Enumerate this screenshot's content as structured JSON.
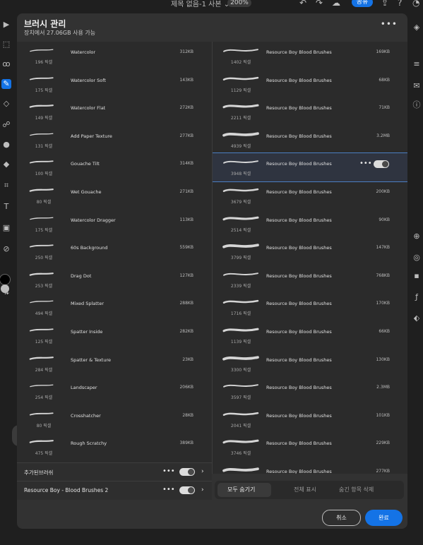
{
  "topbar": {
    "doc_title": "제목 없음-1 사본 ⌄",
    "zoom": "200%",
    "share_label": "공유"
  },
  "dialog": {
    "title": "브러시 관리",
    "subtitle": "장치에서 27.06GB 사용 가능",
    "left_brushes": [
      {
        "name": "Watercolor",
        "size": "312KB",
        "px": "196 픽셀"
      },
      {
        "name": "Watercolor Soft",
        "size": "143KB",
        "px": "175 픽셀"
      },
      {
        "name": "Watercolor Flat",
        "size": "272KB",
        "px": "149 픽셀"
      },
      {
        "name": "Add Paper Texture",
        "size": "277KB",
        "px": "131 픽셀"
      },
      {
        "name": "Gouache Tilt",
        "size": "314KB",
        "px": "100 픽셀"
      },
      {
        "name": "Wet Gouache",
        "size": "271KB",
        "px": "80 픽셀"
      },
      {
        "name": "Watercolor Dragger",
        "size": "113KB",
        "px": "175 픽셀"
      },
      {
        "name": "60s Background",
        "size": "559KB",
        "px": "250 픽셀"
      },
      {
        "name": "Drag Dot",
        "size": "127KB",
        "px": "253 픽셀"
      },
      {
        "name": "Mixed Splatter",
        "size": "288KB",
        "px": "494 픽셀"
      },
      {
        "name": "Spatter Inside",
        "size": "282KB",
        "px": "125 픽셀"
      },
      {
        "name": "Spatter & Texture",
        "size": "23KB",
        "px": "284 픽셀"
      },
      {
        "name": "Landscaper",
        "size": "206KB",
        "px": "254 픽셀"
      },
      {
        "name": "Crosshatcher",
        "size": "28KB",
        "px": "80 픽셀"
      },
      {
        "name": "Rough Scratchy",
        "size": "389KB",
        "px": "475 픽셀"
      }
    ],
    "right_brushes": [
      {
        "name": "Resource Boy Blood Brushes",
        "size": "169KB",
        "px": "1402 픽셀"
      },
      {
        "name": "Resource Boy Blood Brushes",
        "size": "68KB",
        "px": "1129 픽셀"
      },
      {
        "name": "Resource Boy Blood Brushes",
        "size": "71KB",
        "px": "2211 픽셀"
      },
      {
        "name": "Resource Boy Blood Brushes",
        "size": "3.2MB",
        "px": "4939 픽셀"
      },
      {
        "name": "Resource Boy Blood Brushes",
        "size": "",
        "px": "3948 픽셀",
        "selected": true
      },
      {
        "name": "Resource Boy Blood Brushes",
        "size": "200KB",
        "px": "3679 픽셀"
      },
      {
        "name": "Resource Boy Blood Brushes",
        "size": "90KB",
        "px": "2514 픽셀"
      },
      {
        "name": "Resource Boy Blood Brushes",
        "size": "147KB",
        "px": "3799 픽셀"
      },
      {
        "name": "Resource Boy Blood Brushes",
        "size": "768KB",
        "px": "2339 픽셀"
      },
      {
        "name": "Resource Boy Blood Brushes",
        "size": "170KB",
        "px": "1716 픽셀"
      },
      {
        "name": "Resource Boy Blood Brushes",
        "size": "66KB",
        "px": "1139 픽셀"
      },
      {
        "name": "Resource Boy Blood Brushes",
        "size": "130KB",
        "px": "3300 픽셀"
      },
      {
        "name": "Resource Boy Blood Brushes",
        "size": "2.3MB",
        "px": "3597 픽셀"
      },
      {
        "name": "Resource Boy Blood Brushes",
        "size": "101KB",
        "px": "2041 픽셀"
      },
      {
        "name": "Resource Boy Blood Brushes",
        "size": "229KB",
        "px": "3746 픽셀"
      },
      {
        "name": "Resource Boy Blood Brushes",
        "size": "277KB",
        "px": ""
      }
    ],
    "sets": [
      {
        "label": "추가된브러쉬"
      },
      {
        "label": "Resource Boy - Blood Brushes 2"
      }
    ],
    "segment": {
      "hide_all": "모두 숨기기",
      "show_all": "전체 표시",
      "delete_hidden": "숨긴 항목 삭제"
    },
    "cancel_label": "취소",
    "done_label": "완료"
  },
  "colors": {
    "accent": "#1473e6",
    "panel": "#323232",
    "list": "#2b2b2b"
  }
}
